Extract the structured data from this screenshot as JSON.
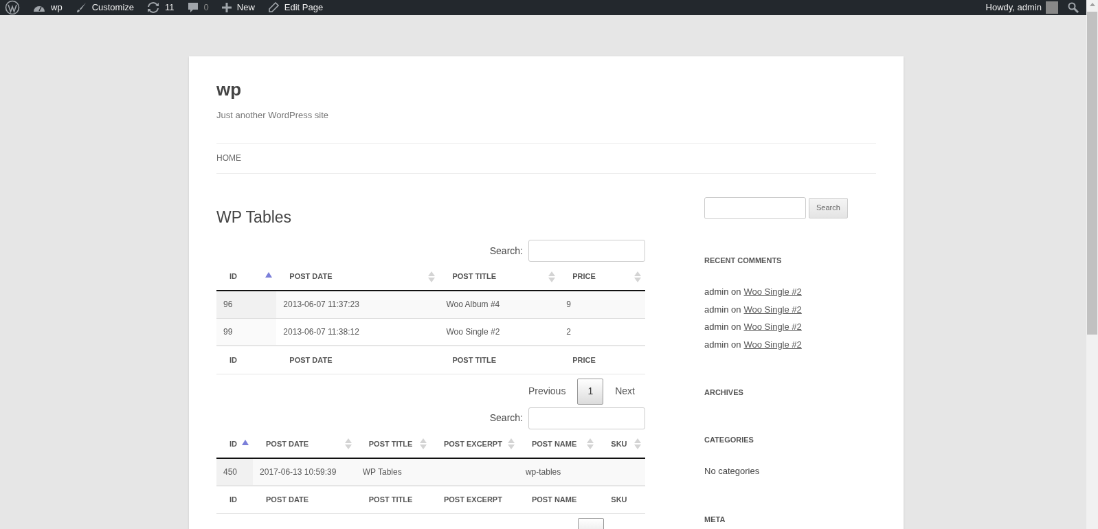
{
  "admin_bar": {
    "left": [
      {
        "kind": "logo"
      },
      {
        "kind": "site",
        "label": "wp"
      },
      {
        "kind": "customize",
        "label": "Customize"
      },
      {
        "kind": "updates",
        "label": "11"
      },
      {
        "kind": "comments",
        "label": "0"
      },
      {
        "kind": "new",
        "label": "New"
      },
      {
        "kind": "edit",
        "label": "Edit Page"
      }
    ],
    "greeting": "Howdy, admin"
  },
  "site": {
    "title": "wp",
    "tagline": "Just another WordPress site"
  },
  "nav": [
    {
      "label": "HOME"
    }
  ],
  "page_title": "WP Tables",
  "tables": [
    {
      "search_label": "Search:",
      "columns": [
        {
          "label": "ID",
          "sorted": true
        },
        {
          "label": "POST DATE",
          "sorted": false
        },
        {
          "label": "POST TITLE",
          "sorted": false
        },
        {
          "label": "PRICE",
          "sorted": false
        }
      ],
      "rows": [
        [
          "96",
          "2013-06-07 11:37:23",
          "Woo Album #4",
          "9"
        ],
        [
          "99",
          "2013-06-07 11:38:12",
          "Woo Single #2",
          "2"
        ]
      ],
      "footer": [
        "ID",
        "POST DATE",
        "POST TITLE",
        "PRICE"
      ],
      "pagination": [
        {
          "label": "Previous",
          "selected": false
        },
        {
          "label": "1",
          "selected": true
        },
        {
          "label": "Next",
          "selected": false
        }
      ]
    },
    {
      "search_label": "Search:",
      "columns": [
        {
          "label": "ID",
          "sorted": true
        },
        {
          "label": "POST DATE",
          "sorted": false
        },
        {
          "label": "POST TITLE",
          "sorted": false
        },
        {
          "label": "POST EXCERPT",
          "sorted": false
        },
        {
          "label": "POST NAME",
          "sorted": false
        },
        {
          "label": "SKU",
          "sorted": false
        }
      ],
      "rows": [
        [
          "450",
          "2017-06-13 10:59:39",
          "WP Tables",
          "",
          "wp-tables",
          ""
        ]
      ],
      "footer": [
        "ID",
        "POST DATE",
        "POST TITLE",
        "POST EXCERPT",
        "POST NAME",
        "SKU"
      ],
      "pagination": [
        {
          "selected": true
        }
      ]
    }
  ],
  "sidebar": {
    "search_button": "Search",
    "widgets": [
      {
        "title": "RECENT COMMENTS",
        "comments": [
          {
            "author": "admin on",
            "link": "Woo Single #2"
          },
          {
            "author": "admin on",
            "link": "Woo Single #2"
          },
          {
            "author": "admin on",
            "link": "Woo Single #2"
          },
          {
            "author": "admin on",
            "link": "Woo Single #2"
          }
        ]
      },
      {
        "title": "ARCHIVES"
      },
      {
        "title": "CATEGORIES",
        "text": "No categories"
      },
      {
        "title": "META"
      }
    ]
  }
}
